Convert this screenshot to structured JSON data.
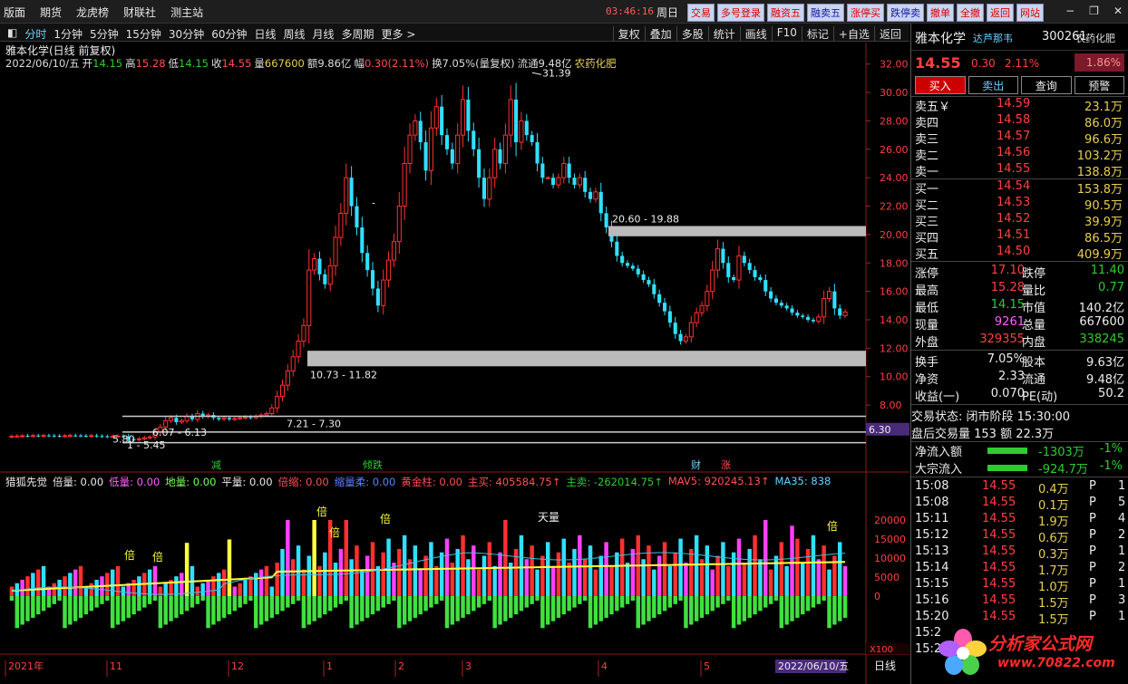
{
  "topbar": {
    "menu": [
      "版面",
      "期货",
      "龙虎榜",
      "财联社",
      "测主站"
    ],
    "time": "03:46:16",
    "weekday": "周日",
    "buttons": [
      "交易",
      "多号登录",
      "融资五",
      "融卖五",
      "涨停买",
      "跌停卖",
      "撤单",
      "全撤",
      "返回",
      "网站"
    ]
  },
  "timeframes": [
    "分时",
    "1分钟",
    "5分钟",
    "15分钟",
    "30分钟",
    "60分钟",
    "日线",
    "周线",
    "月线",
    "多周期",
    "更多 >"
  ],
  "toolbar_right": [
    "复权",
    "叠加",
    "多股",
    "统计",
    "画线",
    "F10",
    "标记",
    "+自选",
    "返回"
  ],
  "chart_header": {
    "line1": "雅本化学(日线 前复权)",
    "date": "2022/06/10/五",
    "open_label": "开",
    "open": "14.15",
    "high_label": "高",
    "high": "15.28",
    "low_label": "低",
    "low": "14.15",
    "close_label": "收",
    "close": "14.55",
    "vol_label": "量",
    "vol": "667600",
    "amount": "额9.86亿",
    "amp_label": "幅",
    "amp": "0.30(2.11%)",
    "turnover": "换7.05%(量复权)",
    "float": "流通9.48亿",
    "sector": "农药化肥"
  },
  "indicator_header": {
    "name": "猎狐先觉",
    "items": [
      {
        "label": "倍量: 0.00",
        "color": "#e8e8e8"
      },
      {
        "label": "低量: 0.00",
        "color": "#ff60ff"
      },
      {
        "label": "地量: 0.00",
        "color": "#7aff5a"
      },
      {
        "label": "平量: 0.00",
        "color": "#e8e8e8"
      },
      {
        "label": "倍缩: 0.00",
        "color": "#ff5050"
      },
      {
        "label": "缩量柔: 0.00",
        "color": "#5a80ff"
      },
      {
        "label": "黄金柱: 0.00",
        "color": "#ff5050"
      },
      {
        "label": "主买: 405584.75↑",
        "color": "#ff5050"
      },
      {
        "label": "主卖: -262014.75↑",
        "color": "#2ecc2e"
      },
      {
        "label": "MAV5: 920245.13↑",
        "color": "#ff5050"
      },
      {
        "label": "MA35: 838",
        "color": "#6ad0ff"
      }
    ]
  },
  "chart_data": {
    "type": "candlestick",
    "ylim": [
      4.5,
      33.0
    ],
    "price_ticks": [
      "32.00",
      "30.00",
      "28.00",
      "26.00",
      "24.00",
      "22.00",
      "20.00",
      "18.00",
      "16.00",
      "14.00",
      "12.00",
      "10.00",
      "8.00"
    ],
    "last_price_tag": "6.30",
    "vol_ticks": [
      "20000",
      "15000",
      "10000",
      "5000",
      "0"
    ],
    "vol_unit": "X100",
    "month_labels": [
      "2021年",
      "11",
      "12",
      "1",
      "2",
      "3",
      "4",
      "5"
    ],
    "date_tag": "2022/06/10/五",
    "annotations": {
      "high": "31.39",
      "low_a": "5.80",
      "low_b": "1 - 5.45",
      "zone1": "20.60 - 19.88",
      "zone2": "10.73 - 11.82",
      "zone3": "7.21 - 7.30",
      "zone4": "6.07 - 6.13",
      "zone_dash": "-"
    },
    "event_markers": [
      "减",
      "倾跌",
      "财",
      "涨"
    ],
    "vol_markers": [
      "倍",
      "倍",
      "倍",
      "倍",
      "倍",
      "天量",
      "倍"
    ],
    "bottom_label": "日线",
    "closes": [
      5.8,
      5.82,
      5.84,
      5.83,
      5.85,
      5.84,
      5.86,
      5.85,
      5.83,
      5.82,
      5.84,
      5.86,
      5.85,
      5.84,
      5.83,
      5.85,
      5.82,
      5.8,
      5.78,
      5.8,
      5.82,
      5.79,
      5.6,
      5.55,
      5.62,
      5.7,
      5.75,
      6.1,
      6.45,
      6.9,
      7.1,
      6.8,
      6.9,
      7.2,
      7.0,
      7.4,
      7.2,
      7.3,
      7.1,
      7.0,
      7.1,
      7.0,
      7.05,
      7.1,
      7.15,
      7.1,
      7.2,
      7.3,
      7.4,
      7.8,
      8.6,
      9.4,
      10.4,
      11.4,
      12.5,
      13.6,
      17.5,
      18.3,
      17.2,
      16.5,
      17.8,
      19.8,
      21.5,
      24.0,
      22.0,
      20.5,
      18.7,
      17.5,
      16.2,
      15.0,
      16.8,
      18.2,
      19.5,
      22.0,
      25.0,
      27.0,
      28.0,
      26.5,
      24.5,
      27.5,
      29.0,
      27.0,
      26.0,
      25.0,
      27.0,
      29.5,
      27.3,
      26.0,
      24.0,
      22.5,
      24.0,
      26.0,
      25.0,
      27.0,
      29.5,
      26.5,
      28.0,
      27.0,
      26.5,
      25.0,
      24.0,
      24.0,
      23.5,
      24.0,
      25.0,
      24.0,
      23.5,
      24.0,
      23.0,
      22.5,
      23.0,
      21.5,
      20.5,
      19.5,
      18.5,
      18.0,
      17.8,
      17.6,
      17.2,
      16.8,
      16.5,
      15.8,
      15.2,
      14.6,
      13.8,
      13.0,
      12.5,
      12.8,
      13.8,
      14.5,
      15.0,
      16.0,
      17.5,
      19.0,
      18.0,
      17.0,
      16.8,
      18.5,
      18.0,
      17.5,
      17.0,
      16.8,
      16.0,
      15.5,
      15.2,
      15.0,
      14.8,
      14.5,
      14.3,
      14.2,
      14.0,
      13.9,
      14.2,
      15.5,
      16.0,
      14.8,
      14.3,
      14.55
    ],
    "volume_note": "volume bars are in units of X100"
  },
  "right_panel": {
    "name": "雅本化学",
    "tag": "达芦那韦",
    "code": "300261",
    "sector": "农药化肥",
    "price": "14.55",
    "change": "0.30",
    "pct": "2.11%",
    "box_pct": "1.86%",
    "buttons": [
      "买入",
      "卖出",
      "查询",
      "预警"
    ],
    "sells": [
      {
        "label": "卖五",
        "extra": "￥",
        "price": "14.59",
        "vol": "23.1万"
      },
      {
        "label": "卖四",
        "extra": "",
        "price": "14.58",
        "vol": "86.0万"
      },
      {
        "label": "卖三",
        "extra": "",
        "price": "14.57",
        "vol": "96.6万"
      },
      {
        "label": "卖二",
        "extra": "",
        "price": "14.56",
        "vol": "103.2万"
      },
      {
        "label": "卖一",
        "extra": "",
        "price": "14.55",
        "vol": "138.8万"
      }
    ],
    "buys": [
      {
        "label": "买一",
        "price": "14.54",
        "vol": "153.8万"
      },
      {
        "label": "买二",
        "price": "14.53",
        "vol": "90.5万"
      },
      {
        "label": "买三",
        "price": "14.52",
        "vol": "39.9万"
      },
      {
        "label": "买四",
        "price": "14.51",
        "vol": "86.5万"
      },
      {
        "label": "买五",
        "price": "14.50",
        "vol": "409.9万"
      }
    ],
    "stats": [
      {
        "a": "涨停",
        "av": "17.10",
        "ac": "red",
        "b": "跌停",
        "bv": "11.40",
        "bc": "green"
      },
      {
        "a": "最高",
        "av": "15.28",
        "ac": "red",
        "b": "量比",
        "bv": "0.77",
        "bc": "green"
      },
      {
        "a": "最低",
        "av": "14.15",
        "ac": "green",
        "b": "市值",
        "bv": "140.2亿",
        "bc": "white"
      },
      {
        "a": "现量",
        "av": "9261",
        "ac": "magenta",
        "b": "总量",
        "bv": "667600",
        "bc": "white"
      },
      {
        "a": "外盘",
        "av": "329355",
        "ac": "red",
        "b": "内盘",
        "bv": "338245",
        "bc": "green"
      }
    ],
    "stats2": [
      {
        "a": "换手",
        "av": "7.05%",
        "ac": "white",
        "b": "股本",
        "bv": "9.63亿",
        "bc": "white"
      },
      {
        "a": "净资",
        "av": "2.33",
        "ac": "white",
        "b": "流通",
        "bv": "9.48亿",
        "bc": "white"
      },
      {
        "a": "收益(一)",
        "av": "0.070",
        "ac": "white",
        "b": "PE(动)",
        "bv": "50.2",
        "bc": "white"
      }
    ],
    "trade_status": "交易状态: 闭市阶段 15:30:00",
    "after_hours": "盘后交易量 153 额 22.3万",
    "flows": [
      {
        "label": "净流入额",
        "value": "-1303万",
        "pct": "-1%"
      },
      {
        "label": "大宗流入",
        "value": "-924.7万",
        "pct": "-1%"
      }
    ],
    "ticks": [
      {
        "t": "15:08",
        "p": "14.55",
        "v": "0.4万",
        "f": "P",
        "n": "1"
      },
      {
        "t": "15:08",
        "p": "14.55",
        "v": "0.1万",
        "f": "P",
        "n": "5"
      },
      {
        "t": "15:11",
        "p": "14.55",
        "v": "1.9万",
        "f": "P",
        "n": "4"
      },
      {
        "t": "15:12",
        "p": "14.55",
        "v": "0.6万",
        "f": "P",
        "n": "2"
      },
      {
        "t": "15:13",
        "p": "14.55",
        "v": "0.3万",
        "f": "P",
        "n": "1"
      },
      {
        "t": "15:14",
        "p": "14.55",
        "v": "1.7万",
        "f": "P",
        "n": "2"
      },
      {
        "t": "15:15",
        "p": "14.55",
        "v": "1.0万",
        "f": "P",
        "n": "1"
      },
      {
        "t": "15:16",
        "p": "14.55",
        "v": "1.5万",
        "f": "P",
        "n": "3"
      },
      {
        "t": "15:20",
        "p": "14.55",
        "v": "1.5万",
        "f": "P",
        "n": "1"
      },
      {
        "t": "15:2",
        "p": "",
        "v": "",
        "f": "",
        "n": ""
      },
      {
        "t": "15:2",
        "p": "",
        "v": "",
        "f": "",
        "n": ""
      }
    ]
  },
  "logo": {
    "title": "分析家公式网",
    "url": "www.70822.com"
  }
}
